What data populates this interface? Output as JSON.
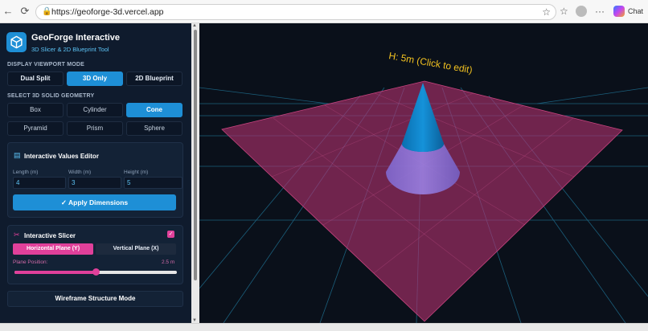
{
  "browser": {
    "url": "https://geoforge-3d.vercel.app",
    "chat_label": "Chat"
  },
  "sidebar": {
    "app_title": "GeoForge Interactive",
    "app_subtitle": "3D Slicer & 2D Blueprint Tool",
    "viewport_mode": {
      "label": "DISPLAY VIEWPORT MODE",
      "options": [
        "Dual Split",
        "3D Only",
        "2D Blueprint"
      ],
      "selected": "3D Only"
    },
    "geometry": {
      "label": "SELECT 3D SOLID GEOMETRY",
      "options": [
        "Box",
        "Cylinder",
        "Cone",
        "Pyramid",
        "Prism",
        "Sphere"
      ],
      "selected": "Cone"
    },
    "values_editor": {
      "title": "Interactive Values Editor",
      "length_label": "Length (m)",
      "length_value": "4",
      "width_label": "Width (m)",
      "width_value": "3",
      "height_label": "Height (m)",
      "height_value": "5",
      "apply_label": "Apply Dimensions"
    },
    "slicer": {
      "title": "Interactive Slicer",
      "enabled": true,
      "horizontal_label": "Horizontal Plane (Y)",
      "vertical_label": "Vertical Plane (X)",
      "selected_plane": "Horizontal Plane (Y)",
      "position_label": "Plane Position:",
      "position_value": "2.5 m",
      "position_fraction": 0.5
    },
    "wireframe_label": "Wireframe Structure Mode"
  },
  "viewport": {
    "height_annotation": "H: 5m (Click to edit)",
    "colors": {
      "background": "#0a101a",
      "grid": "#1f6f8f",
      "plane": "#b0306e",
      "cone_top": "#0e7fc4",
      "cone_bottom": "#8d72d8",
      "annotation": "#f0c020"
    }
  }
}
